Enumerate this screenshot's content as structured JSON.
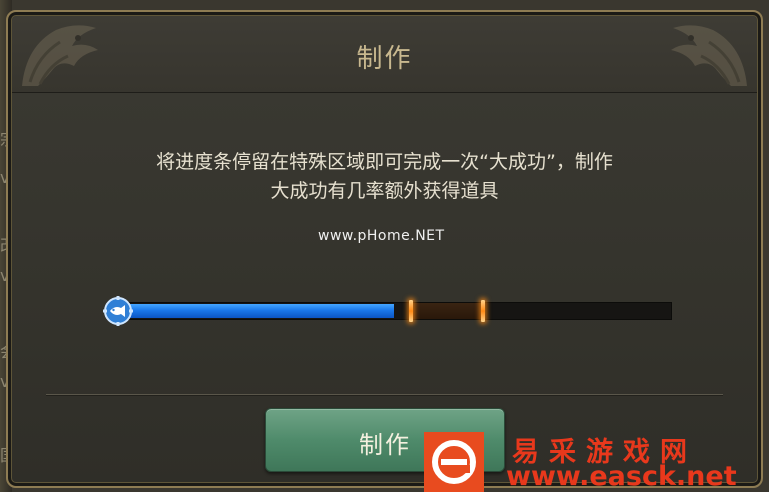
{
  "dialog": {
    "title": "制作",
    "description_line1": "将进度条停留在特殊区域即可完成一次“大成功”，制作",
    "description_line2": "大成功有几率额外获得道具",
    "button_label": "制作"
  },
  "progress": {
    "fill_fraction": 0.5,
    "special_zone_start_fraction": 0.53,
    "special_zone_end_fraction": 0.66,
    "knob_icon": "fish-icon",
    "bar_color": "#1a78ea",
    "zone_marker_color": "#ff8a16"
  },
  "watermarks": {
    "center_text": "www.pHome.NET",
    "site_name": "易采游戏网",
    "site_url": "www.easck.net",
    "logo_icon": "e-logo-icon",
    "brand_color": "#e8381c"
  },
  "background_ui": {
    "glyphs": [
      "宗",
      "v",
      "改",
      "v",
      "会",
      "v",
      "国"
    ]
  }
}
